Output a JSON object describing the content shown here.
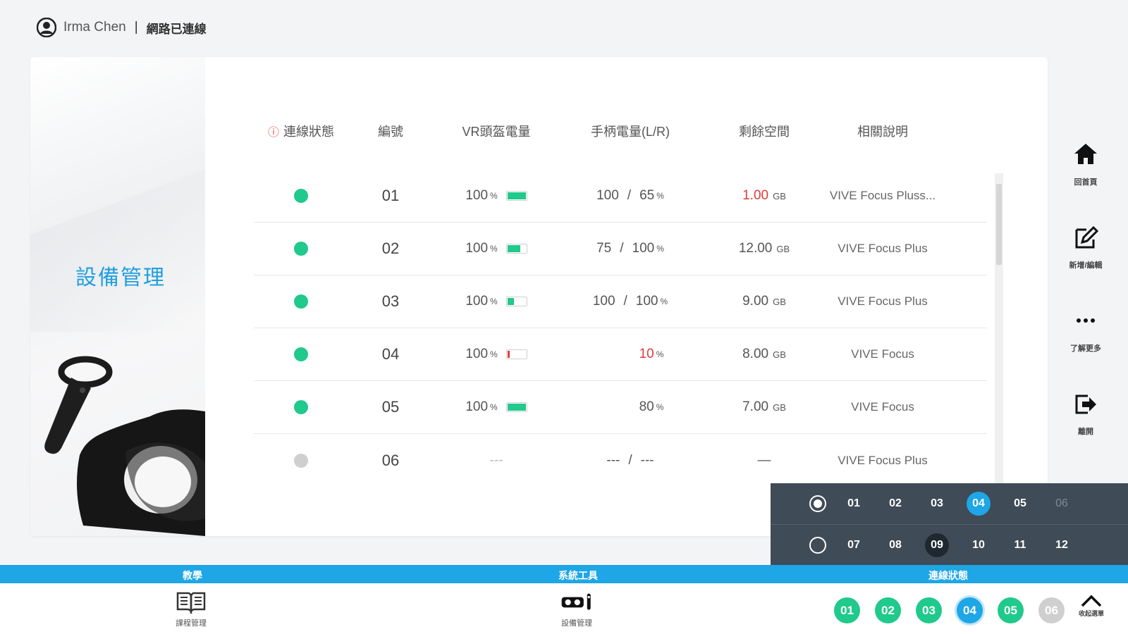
{
  "user": {
    "name": "Irma Chen",
    "separator": "|",
    "network_status": "網路已連線"
  },
  "page": {
    "title": "設備管理"
  },
  "table": {
    "headers": [
      "連線狀態",
      "編號",
      "VR頭盔電量",
      "手柄電量(L/R)",
      "剩餘空間",
      "相關說明"
    ],
    "rows": [
      {
        "connected": true,
        "id": "01",
        "headset": "100",
        "headset_level": 1.0,
        "left": "100",
        "right": "65",
        "space": "1.00",
        "space_alert": true,
        "desc": "VIVE Focus Pluss..."
      },
      {
        "connected": true,
        "id": "02",
        "headset": "100",
        "headset_level": 0.7,
        "left": "75",
        "right": "100",
        "space": "12.00",
        "space_alert": false,
        "desc": "VIVE Focus Plus"
      },
      {
        "connected": true,
        "id": "03",
        "headset": "100",
        "headset_level": 0.35,
        "left": "100",
        "right": "100",
        "space": "9.00",
        "space_alert": false,
        "desc": "VIVE Focus Plus"
      },
      {
        "connected": true,
        "id": "04",
        "headset": "100",
        "headset_level": 0.12,
        "left": "",
        "right": "10",
        "right_alert": true,
        "space": "8.00",
        "space_alert": false,
        "desc": "VIVE Focus"
      },
      {
        "connected": true,
        "id": "05",
        "headset": "100",
        "headset_level": 1.0,
        "left": "",
        "right": "80",
        "space": "7.00",
        "space_alert": false,
        "desc": "VIVE Focus"
      },
      {
        "connected": false,
        "id": "06",
        "headset": "---",
        "left": "---",
        "right": "---",
        "space": "—",
        "desc": "VIVE Focus Plus"
      }
    ],
    "percent_unit": "%",
    "space_unit": "GB"
  },
  "rightnav": [
    {
      "label": "回首頁",
      "icon": "home-icon"
    },
    {
      "label": "新增/編輯",
      "icon": "edit-icon"
    },
    {
      "label": "了解更多",
      "icon": "more-icon"
    },
    {
      "label": "離開",
      "icon": "exit-icon"
    }
  ],
  "selector": {
    "row1": [
      {
        "id": "01",
        "state": "normal"
      },
      {
        "id": "02",
        "state": "normal"
      },
      {
        "id": "03",
        "state": "normal"
      },
      {
        "id": "04",
        "state": "selected"
      },
      {
        "id": "05",
        "state": "normal"
      },
      {
        "id": "06",
        "state": "disabled"
      }
    ],
    "row2": [
      {
        "id": "07",
        "state": "normal"
      },
      {
        "id": "08",
        "state": "normal"
      },
      {
        "id": "09",
        "state": "active"
      },
      {
        "id": "10",
        "state": "normal"
      },
      {
        "id": "11",
        "state": "normal"
      },
      {
        "id": "12",
        "state": "normal"
      }
    ]
  },
  "bottombar": {
    "teach": "教學",
    "tools": "系統工具",
    "connection": "連線狀態"
  },
  "footer": {
    "course_label": "課程管理",
    "device_label": "設備管理",
    "devices": [
      {
        "id": "01",
        "state": "on"
      },
      {
        "id": "02",
        "state": "on"
      },
      {
        "id": "03",
        "state": "on"
      },
      {
        "id": "04",
        "state": "selected"
      },
      {
        "id": "05",
        "state": "on"
      },
      {
        "id": "06",
        "state": "off"
      }
    ],
    "collapse_label": "收起選單"
  },
  "colors": {
    "accent": "#1ea6e6",
    "online": "#20c98c",
    "offline": "#cfcfcf",
    "alert": "#e03b3b",
    "selector_bg": "#3f4b56"
  }
}
